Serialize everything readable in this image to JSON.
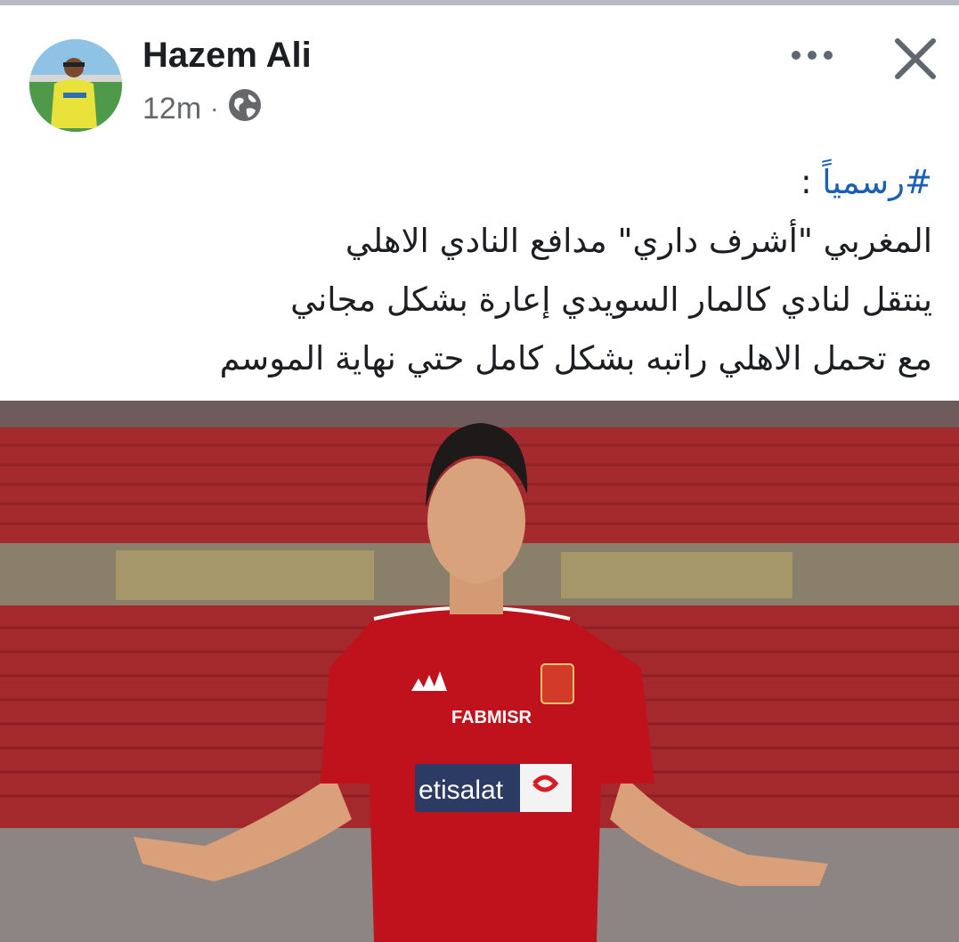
{
  "post": {
    "author": "Hazem Ali",
    "time": "12m",
    "separator": "·",
    "audience_icon": "globe-icon",
    "hashtag": "#رسمياً",
    "hashtag_suffix": " :",
    "lines": [
      "المغربي \"أشرف داري\" مدافع النادي الاهلي",
      "ينتقل لنادي كالمار السويدي إعارة بشكل مجاني",
      "مع تحمل الاهلي راتبه بشكل كامل حتي نهاية الموسم"
    ]
  },
  "photo": {
    "jersey_sponsor_top": "FABMISR",
    "jersey_sponsor_main": "etisalat"
  },
  "colors": {
    "hashtag": "#1b5fb4",
    "kit_red": "#c0121c",
    "stands_red": "#a92a2e"
  }
}
